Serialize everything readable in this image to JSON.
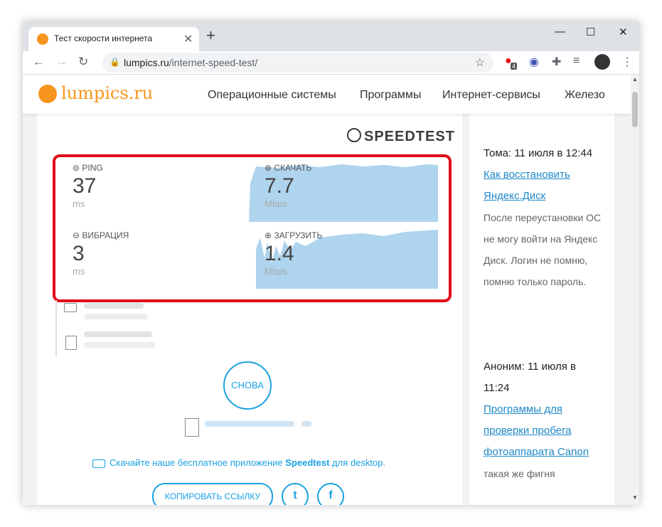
{
  "browser": {
    "tab_title": "Тест скорости интернета",
    "tab_close": "✕",
    "new_tab": "+",
    "url_domain": "lumpics.ru",
    "url_path": "/internet-speed-test/",
    "extension_badge": "4",
    "min": "—",
    "max": "☐",
    "close": "✕"
  },
  "site": {
    "logo": "lumpics.ru",
    "menu": [
      "Операционные системы",
      "Программы",
      "Интернет-сервисы",
      "Железо"
    ]
  },
  "speedtest": {
    "logo": "SPEEDTEST",
    "ping_label": "PING",
    "ping_value": "37",
    "ping_unit": "ms",
    "download_label": "СКАЧАТЬ",
    "download_value": "7.7",
    "download_unit": "Mbps",
    "jitter_label": "ВИБРАЦИЯ",
    "jitter_value": "3",
    "jitter_unit": "ms",
    "upload_label": "ЗАГРУЗИТЬ",
    "upload_value": "1.4",
    "upload_unit": "Mbps",
    "again_label": "СНОВА",
    "download_app_text": "Скачайте наше бесплатное приложение",
    "download_app_brand": "Speedtest",
    "download_app_suffix": "для desktop.",
    "copy_link_label": "КОПИРОВАТЬ ССЫЛКУ",
    "twitter": "t",
    "facebook": "f"
  },
  "sidebar": {
    "comments": [
      {
        "author": "Тома: 11 июля в 12:44",
        "link": "Как восстановить Яндекс.Диск",
        "text": "После переустановки ОС не могу войти на Яндекс Диск. Логин не помню, помню только пароль."
      },
      {
        "author": "Аноним: 11 июля в 11:24",
        "link": "Программы для проверки пробега фотоаппарата Canon",
        "text": "такая же фигня"
      }
    ]
  },
  "colors": {
    "accent": "#1ba1e2",
    "highlight": "#e30d18",
    "chart_fill": "#aed4ee",
    "brand": "#f7941d"
  }
}
